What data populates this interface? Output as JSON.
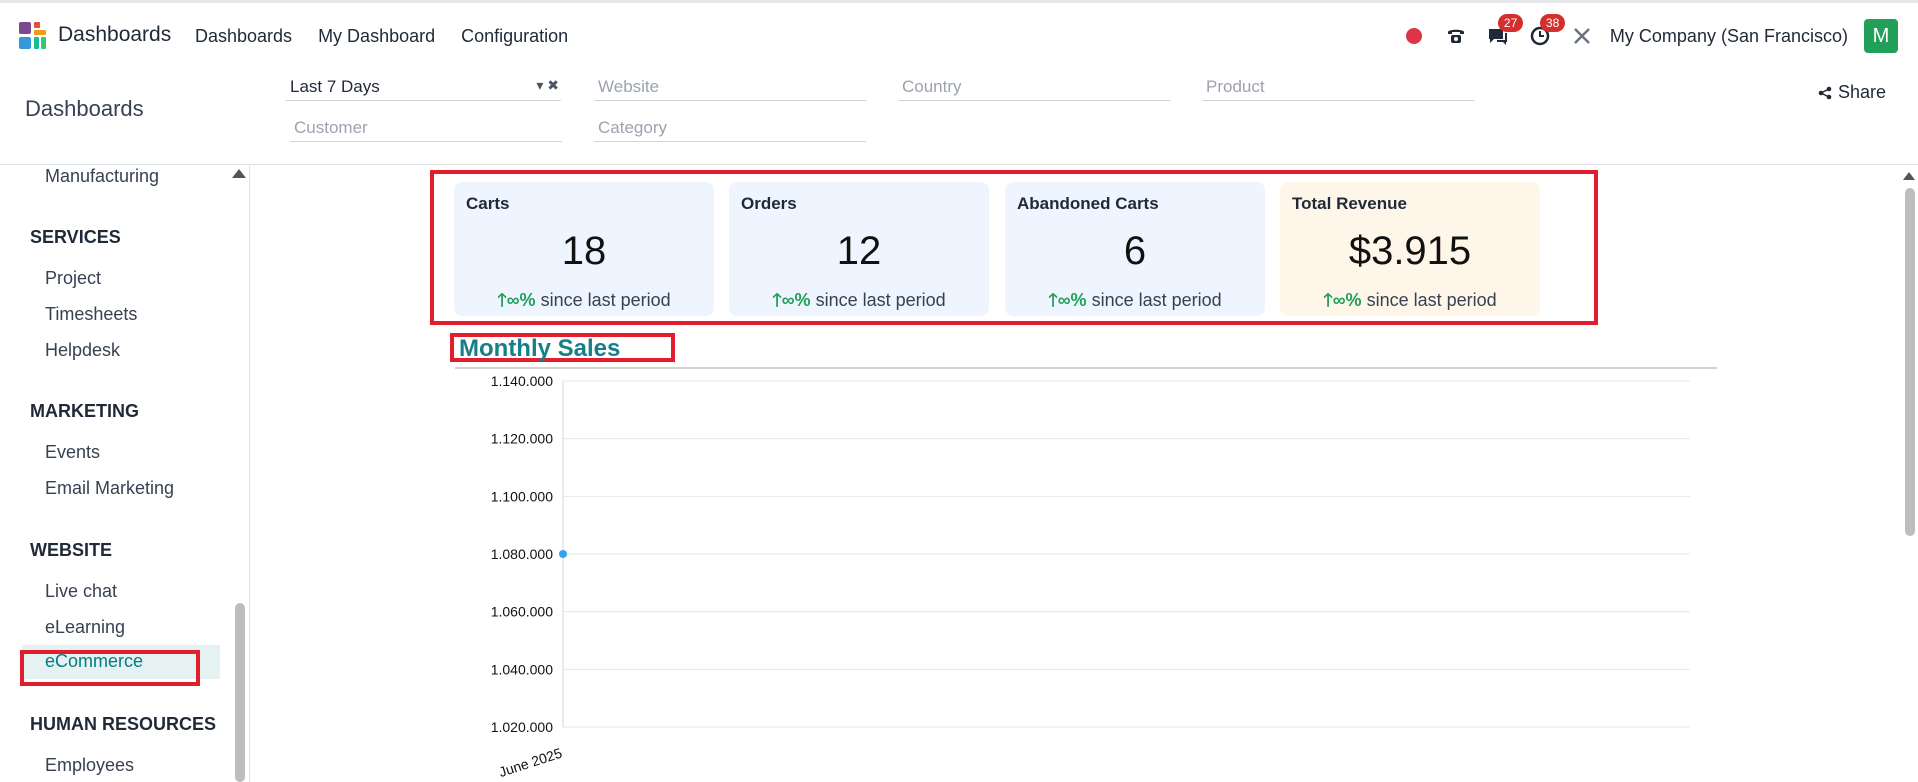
{
  "app": {
    "name": "Dashboards",
    "nav": [
      "Dashboards",
      "My Dashboard",
      "Configuration"
    ]
  },
  "systray": {
    "messages_badge": "27",
    "activities_badge": "38",
    "company": "My Company (San Francisco)",
    "avatar_letter": "M",
    "icons": [
      "recording-dot-icon",
      "phone-icon",
      "chat-icon",
      "clock-icon",
      "tools-icon"
    ]
  },
  "control": {
    "title": "Dashboards",
    "share_label": "Share",
    "filters": {
      "period": "Last 7 Days",
      "website": "Website",
      "country": "Country",
      "product": "Product",
      "customer": "Customer",
      "category": "Category"
    }
  },
  "sidebar": {
    "top_item": "Manufacturing",
    "sections": [
      {
        "title": "SERVICES",
        "items": [
          "Project",
          "Timesheets",
          "Helpdesk"
        ]
      },
      {
        "title": "MARKETING",
        "items": [
          "Events",
          "Email Marketing"
        ]
      },
      {
        "title": "WEBSITE",
        "items": [
          "Live chat",
          "eLearning",
          "eCommerce"
        ]
      },
      {
        "title": "HUMAN RESOURCES",
        "items": [
          "Employees"
        ]
      }
    ],
    "active": "eCommerce"
  },
  "kpis": [
    {
      "title": "Carts",
      "value": "18",
      "delta": "∞%",
      "suffix": "since last period"
    },
    {
      "title": "Orders",
      "value": "12",
      "delta": "∞%",
      "suffix": "since last period"
    },
    {
      "title": "Abandoned Carts",
      "value": "6",
      "delta": "∞%",
      "suffix": "since last period"
    },
    {
      "title": "Total Revenue",
      "value": "$3.915",
      "delta": "∞%",
      "suffix": "since last period"
    }
  ],
  "chart_data": {
    "type": "line",
    "title": "Monthly Sales",
    "x": [
      "June 2025"
    ],
    "series": [
      {
        "values": [
          1080000
        ]
      }
    ],
    "ylim": [
      1020000,
      1140000
    ],
    "yticks": [
      "1.020.000",
      "1.040.000",
      "1.060.000",
      "1.080.000",
      "1.100.000",
      "1.120.000",
      "1.140.000"
    ],
    "grid": true,
    "color": "#36a2eb"
  }
}
